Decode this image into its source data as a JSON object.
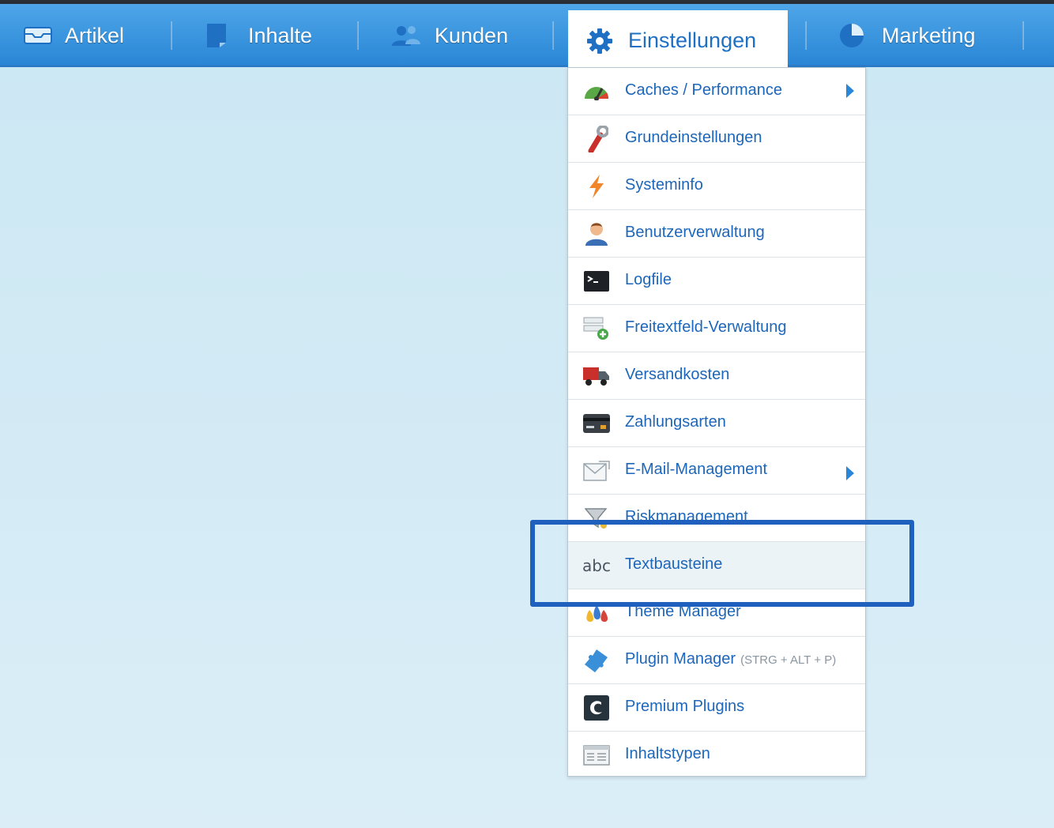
{
  "nav": {
    "items": [
      {
        "label": "Artikel",
        "icon": "inbox-icon"
      },
      {
        "label": "Inhalte",
        "icon": "document-icon"
      },
      {
        "label": "Kunden",
        "icon": "users-icon"
      },
      {
        "label": "Einstellungen",
        "icon": "gear-icon",
        "active": true
      },
      {
        "label": "Marketing",
        "icon": "pie-chart-icon"
      }
    ]
  },
  "menu": {
    "items": [
      {
        "label": "Caches / Performance",
        "icon": "speedometer-icon",
        "submenu": true
      },
      {
        "label": "Grundeinstellungen",
        "icon": "wrench-icon"
      },
      {
        "label": "Systeminfo",
        "icon": "lightning-icon"
      },
      {
        "label": "Benutzerverwaltung",
        "icon": "user-icon"
      },
      {
        "label": "Logfile",
        "icon": "terminal-icon"
      },
      {
        "label": "Freitextfeld-Verwaltung",
        "icon": "add-field-icon"
      },
      {
        "label": "Versandkosten",
        "icon": "truck-icon"
      },
      {
        "label": "Zahlungsarten",
        "icon": "credit-card-icon"
      },
      {
        "label": "E-Mail-Management",
        "icon": "envelope-icon",
        "submenu": true
      },
      {
        "label": "Riskmanagement",
        "icon": "filter-icon"
      },
      {
        "label": "Textbausteine",
        "icon": "abc-icon",
        "highlighted": true
      },
      {
        "label": "Theme Manager",
        "icon": "paint-drops-icon"
      },
      {
        "label": "Plugin Manager",
        "shortcut": "(STRG + ALT + P)",
        "icon": "puzzle-icon"
      },
      {
        "label": "Premium Plugins",
        "icon": "shopware-logo-icon"
      },
      {
        "label": "Inhaltstypen",
        "icon": "content-types-icon"
      }
    ],
    "abc_glyph": "abc"
  },
  "colors": {
    "nav_gradient_top": "#4ea6e8",
    "nav_gradient_bottom": "#2a86d6",
    "menu_text": "#1d66b9",
    "highlight_border": "#1f5fbe",
    "background": "#cbe7f3"
  }
}
